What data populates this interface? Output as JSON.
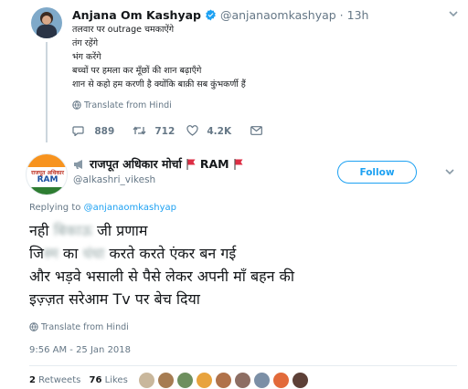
{
  "colors": {
    "accent": "#1da1f2",
    "muted": "#657786",
    "text": "#14171a",
    "thread_line": "#ccd6dd",
    "verified": "#1da1f2"
  },
  "tweet1": {
    "author_name": "Anjana Om Kashyap",
    "handle": "@anjanaomkashyap",
    "dot": "·",
    "time": "13h",
    "lines": [
      "तलवार पर outrage चमकाऐंगे",
      "तंग रहेंगे",
      "भंग करेंगे",
      "बच्चों पर हमला कर मूँछों की शान बढ़ाएँगे",
      "शान से कहो हम करणी है क्योंकि बाक़ी सब कुंभकर्णी हैं"
    ],
    "translate_label": "Translate from Hindi",
    "actions": {
      "replies": "889",
      "retweets": "712",
      "likes": "4.2K"
    },
    "icons": {
      "verified": "verified-badge-icon",
      "globe": "globe-icon",
      "reply": "reply-icon",
      "retweet": "retweet-icon",
      "like": "heart-icon",
      "share": "envelope-icon",
      "menu": "chevron-down-icon"
    }
  },
  "tweet2": {
    "author_name_prefix": "राजपूत अधिकार मोर्चा",
    "author_name_suffix": "RAM",
    "handle": "@alkashri_vikesh",
    "follow_label": "Follow",
    "avatar_text_top": "राजपूत अधिकार",
    "avatar_text_mid": "RAM",
    "replying_to_label": "Replying to",
    "replying_to_handle": "@anjanaomkashyap",
    "line1_a": "नही",
    "line1_blur": "बिकाऊ",
    "line1_b": "जी प्रणाम",
    "line2_a": "जि",
    "line2_blur1": "स्म",
    "line2_b": "का",
    "line2_blur2": "धंधा",
    "line2_c": "करते करते एंकर बन गई",
    "line3": "और भड़वे भसाली से पैसे लेकर अपनी माँ बहन की",
    "line4": "इज़्ज़त सरेआम Tv पर  बेच दिया",
    "translate_label": "Translate from Hindi",
    "timestamp": "9:56 AM - 25 Jan 2018",
    "retweets_count": "2",
    "retweets_label": "Retweets",
    "likes_count": "76",
    "likes_label": "Likes",
    "icons": {
      "globe": "globe-icon",
      "megaphone": "megaphone-icon",
      "flag": "red-flag-icon"
    }
  }
}
